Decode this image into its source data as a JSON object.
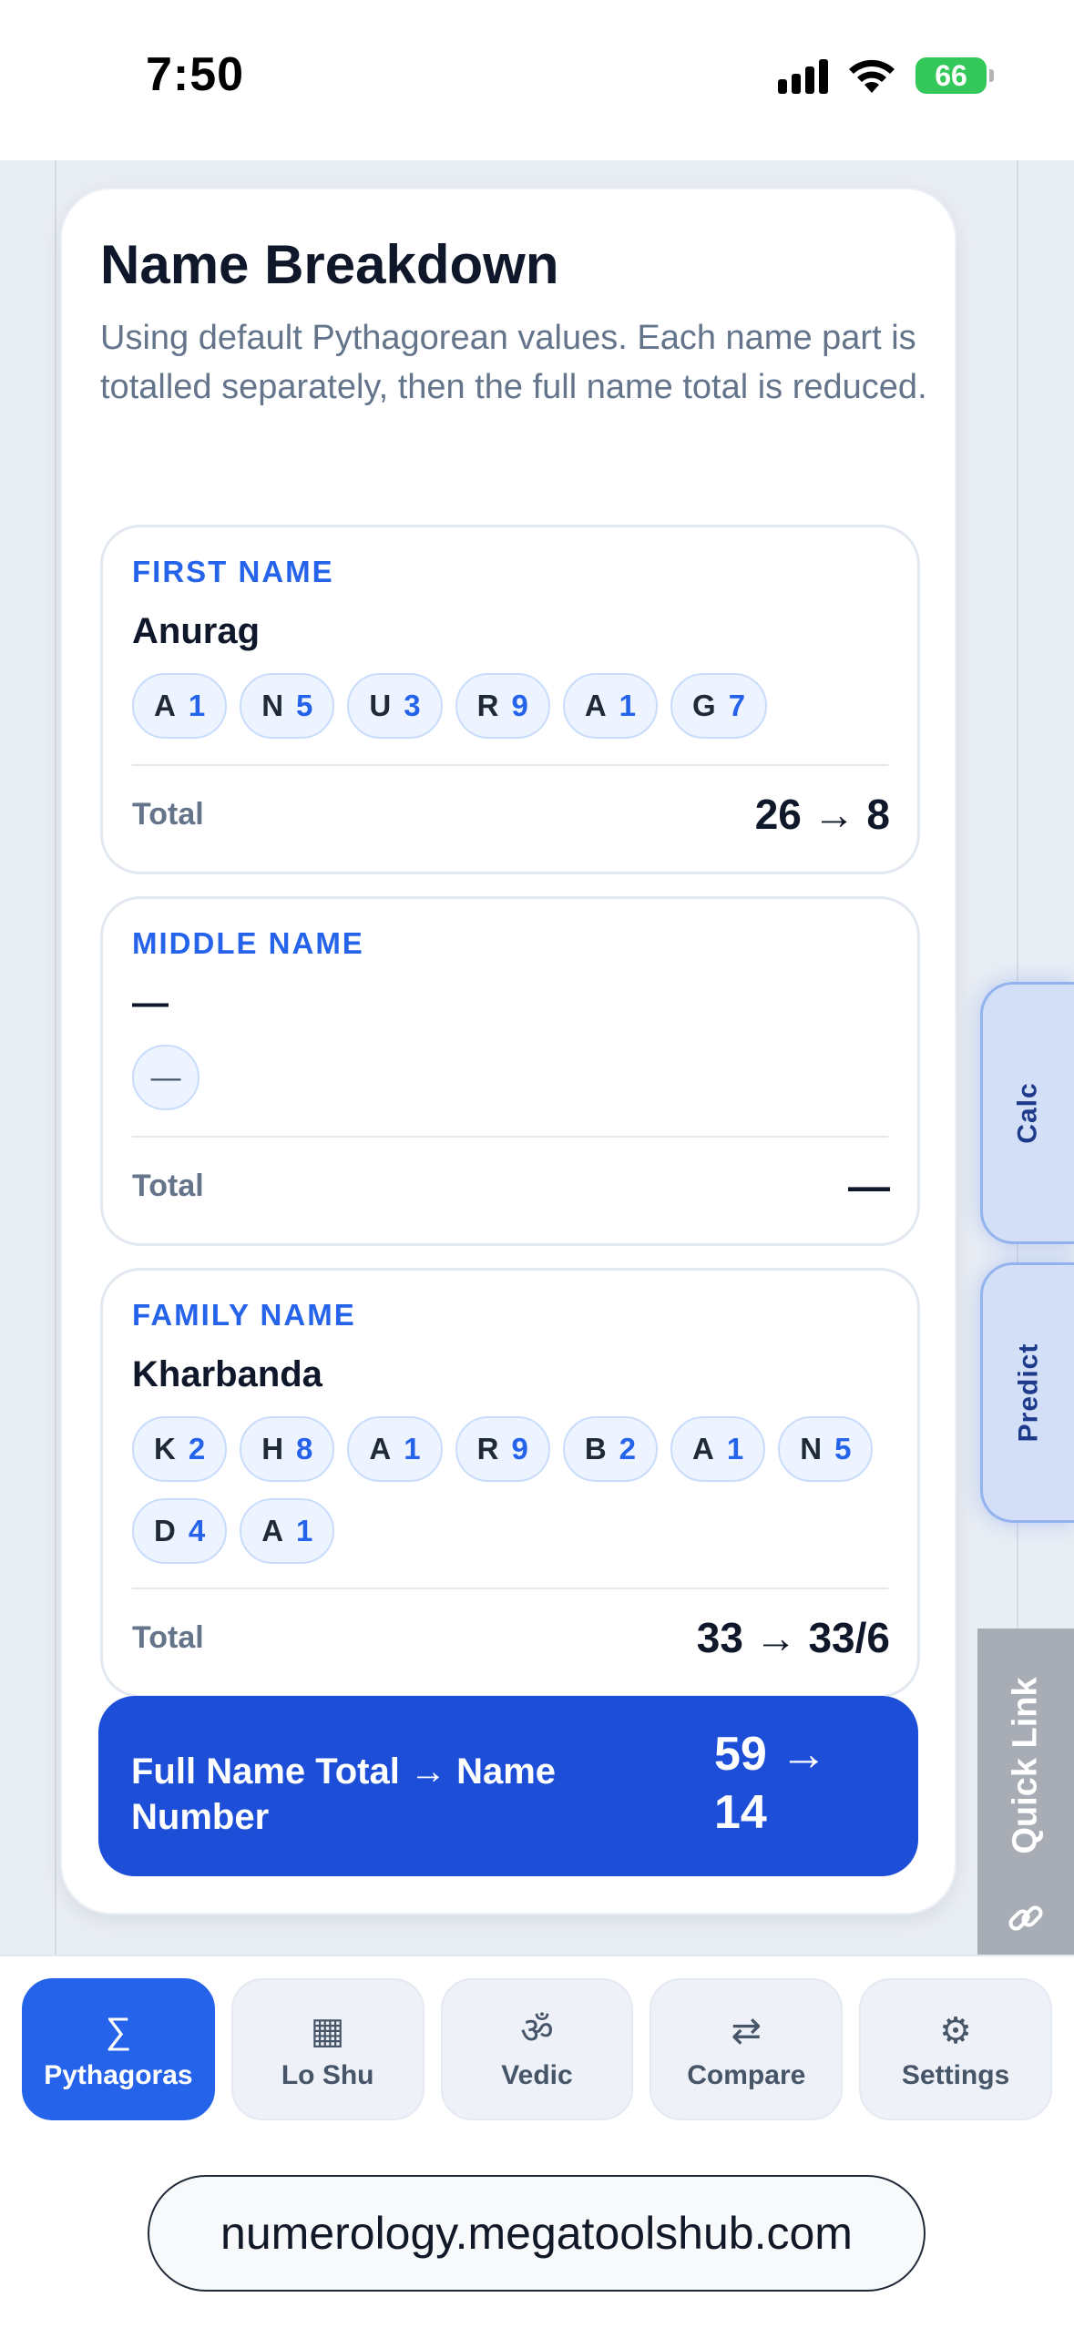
{
  "status_bar": {
    "time": "7:50",
    "battery": "66"
  },
  "card": {
    "title": "Name Breakdown",
    "description": "Using default Pythagorean values. Each name part is totalled separately, then the full name total is reduced."
  },
  "first_name": {
    "label": "FIRST NAME",
    "name": "Anurag",
    "letters": [
      {
        "l": "A",
        "v": "1"
      },
      {
        "l": "N",
        "v": "5"
      },
      {
        "l": "U",
        "v": "3"
      },
      {
        "l": "R",
        "v": "9"
      },
      {
        "l": "A",
        "v": "1"
      },
      {
        "l": "G",
        "v": "7"
      }
    ],
    "total_label": "Total",
    "total_value": "26 → 8"
  },
  "middle_name": {
    "label": "MIDDLE NAME",
    "name": "—",
    "empty_chip": "—",
    "total_label": "Total",
    "total_value": "—"
  },
  "family_name": {
    "label": "FAMILY NAME",
    "name": "Kharbanda",
    "letters": [
      {
        "l": "K",
        "v": "2"
      },
      {
        "l": "H",
        "v": "8"
      },
      {
        "l": "A",
        "v": "1"
      },
      {
        "l": "R",
        "v": "9"
      },
      {
        "l": "B",
        "v": "2"
      },
      {
        "l": "A",
        "v": "1"
      },
      {
        "l": "N",
        "v": "5"
      },
      {
        "l": "D",
        "v": "4"
      },
      {
        "l": "A",
        "v": "1"
      }
    ],
    "total_label": "Total",
    "total_value": "33 → 33/6"
  },
  "full_total": {
    "label": "Full Name Total → Name Number",
    "value": "59 → 14"
  },
  "side_tabs": {
    "calc": "Calc",
    "predict": "Predict",
    "quick_link": "Quick Link"
  },
  "bottom_nav": [
    {
      "icon": "∑",
      "label": "Pythagoras",
      "active": true
    },
    {
      "icon": "▦",
      "label": "Lo Shu",
      "active": false
    },
    {
      "icon": "ॐ",
      "label": "Vedic",
      "active": false
    },
    {
      "icon": "⇄",
      "label": "Compare",
      "active": false
    },
    {
      "icon": "⚙",
      "label": "Settings",
      "active": false
    }
  ],
  "url": "numerology.megatoolshub.com",
  "colors": {
    "accent": "#2563eb",
    "accent_dark": "#1d4ed8",
    "battery": "#34c759"
  }
}
